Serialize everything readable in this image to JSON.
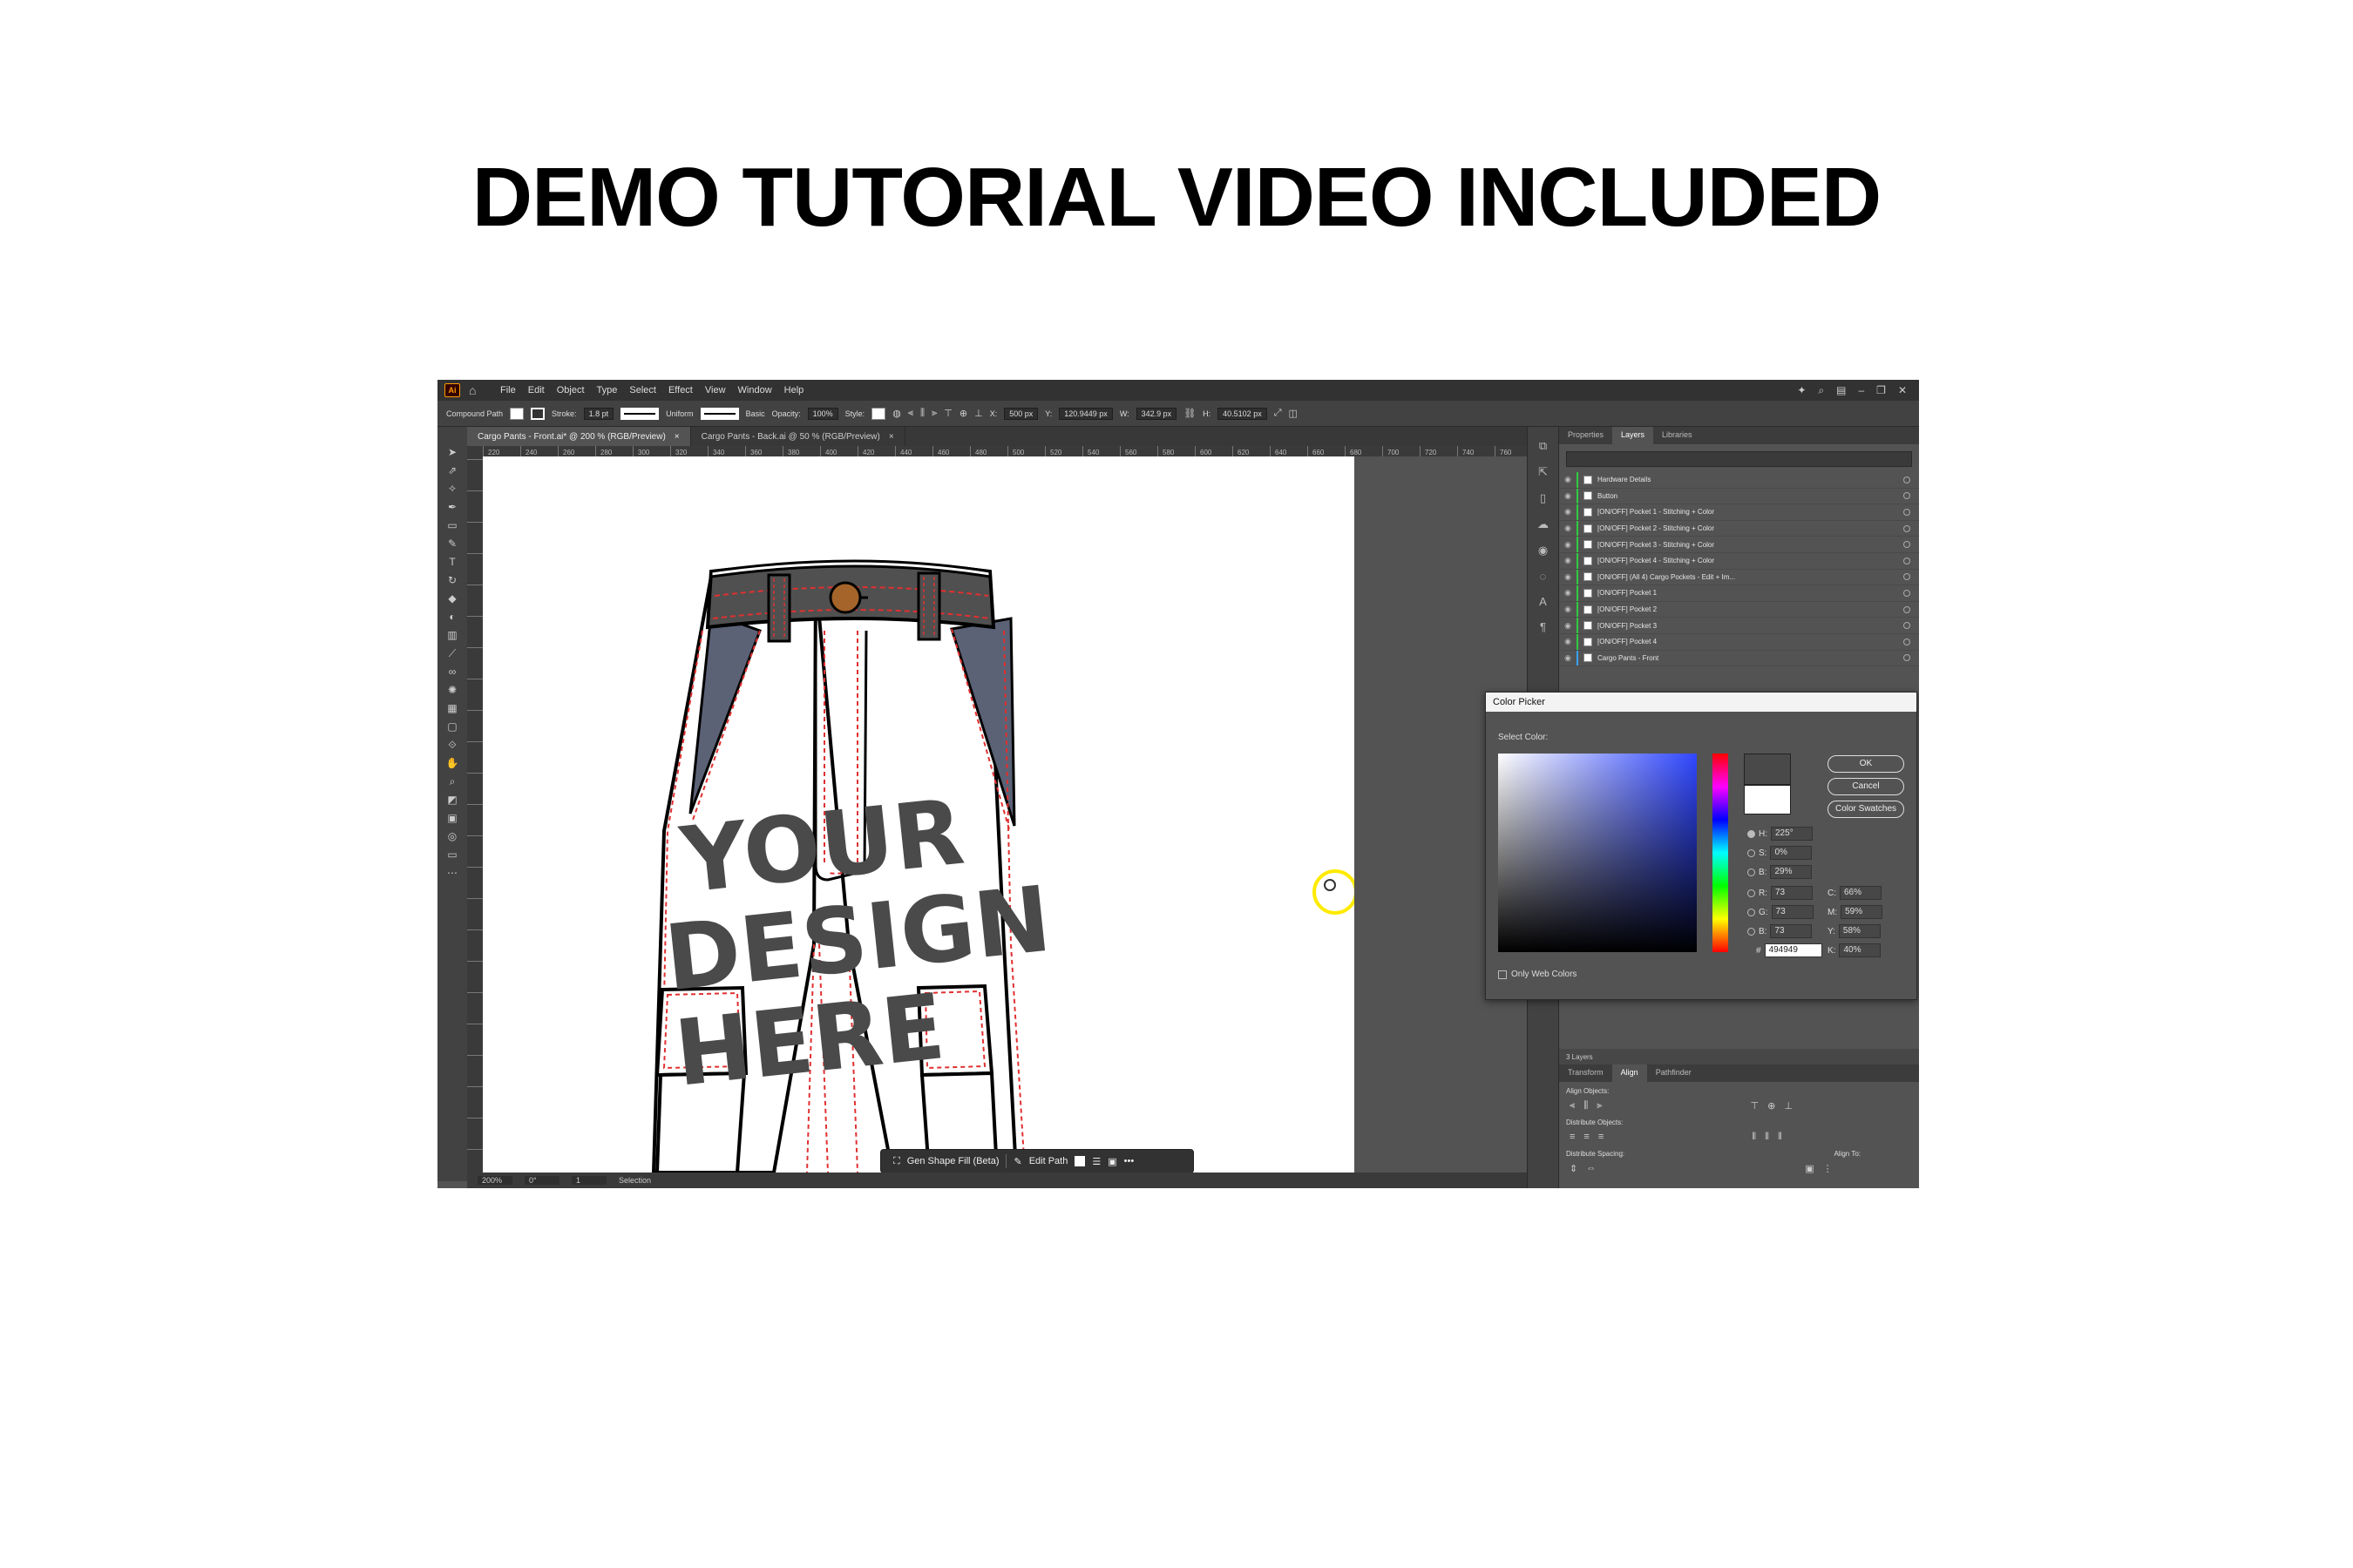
{
  "headline": "DEMO TUTORIAL VIDEO INCLUDED",
  "app": {
    "logo": "Ai",
    "menu": [
      "File",
      "Edit",
      "Object",
      "Type",
      "Select",
      "Effect",
      "View",
      "Window",
      "Help"
    ],
    "control": {
      "object_type": "Compound Path",
      "stroke_label": "Stroke:",
      "stroke_value": "1.8 pt",
      "profile": "Uniform",
      "brush": "Basic",
      "opacity_label": "Opacity:",
      "opacity": "100%",
      "style_label": "Style:",
      "x_label": "X:",
      "x": "500 px",
      "y_label": "Y:",
      "y": "120.9449 px",
      "w_label": "W:",
      "w": "342.9 px",
      "h_label": "H:",
      "h": "40.5102 px"
    },
    "tabs": [
      {
        "label": "Cargo Pants - Front.ai* @ 200 % (RGB/Preview)",
        "close": "×"
      },
      {
        "label": "Cargo Pants - Back.ai @ 50 % (RGB/Preview)",
        "close": "×"
      }
    ],
    "ruler_ticks": [
      "220",
      "240",
      "260",
      "280",
      "300",
      "320",
      "340",
      "360",
      "380",
      "400",
      "420",
      "440",
      "460",
      "480",
      "500",
      "520",
      "540",
      "560",
      "580",
      "600",
      "620",
      "640",
      "660",
      "680",
      "700",
      "720",
      "740",
      "760"
    ],
    "artwork_text": [
      "YOUR",
      "DESIGN",
      "HERE"
    ],
    "context_bar": {
      "gen_fill": "Gen Shape Fill (Beta)",
      "edit_path": "Edit Path",
      "more": "•••"
    },
    "status": {
      "zoom": "200%",
      "rotate": "0°",
      "artboard": "1",
      "tool": "Selection"
    },
    "panel_tabs": [
      "Properties",
      "Layers",
      "Libraries"
    ],
    "active_panel": "Layers",
    "layers": [
      {
        "name": "Hardware Details",
        "bar": "green"
      },
      {
        "name": "Button",
        "bar": "green"
      },
      {
        "name": "[ON/OFF] Pocket 1 - Stitching + Color",
        "bar": "green"
      },
      {
        "name": "[ON/OFF] Pocket 2 - Stitching + Color",
        "bar": "green"
      },
      {
        "name": "[ON/OFF] Pocket 3 - Stitching + Color",
        "bar": "green"
      },
      {
        "name": "[ON/OFF] Pocket 4 - Stitching + Color",
        "bar": "green"
      },
      {
        "name": "[ON/OFF] (All 4) Cargo Pockets - Edit + Im...",
        "bar": "green"
      },
      {
        "name": "[ON/OFF] Pocket 1",
        "bar": "green"
      },
      {
        "name": "[ON/OFF] Pocket 2",
        "bar": "green"
      },
      {
        "name": "[ON/OFF] Pocket 3",
        "bar": "green"
      },
      {
        "name": "[ON/OFF] Pocket 4",
        "bar": "green"
      },
      {
        "name": "Cargo Pants - Front",
        "bar": "blue"
      }
    ],
    "layers_count": "3 Layers",
    "align_tabs": [
      "Transform",
      "Align",
      "Pathfinder"
    ],
    "align_sections": {
      "align_objects": "Align Objects:",
      "distribute_objects": "Distribute Objects:",
      "distribute_spacing": "Distribute Spacing:",
      "align_to": "Align To:"
    },
    "color_picker": {
      "title": "Color Picker",
      "select_color": "Select Color:",
      "ok": "OK",
      "cancel": "Cancel",
      "swatches": "Color Swatches",
      "h_label": "H:",
      "h": "225°",
      "s_label": "S:",
      "s": "0%",
      "b_label": "B:",
      "b": "29%",
      "r_label": "R:",
      "r": "73",
      "g_label": "G:",
      "g": "73",
      "bl_label": "B:",
      "bl": "73",
      "c_label": "C:",
      "c": "66%",
      "m_label": "M:",
      "m": "59%",
      "yy_label": "Y:",
      "yy": "58%",
      "k_label": "K:",
      "k": "40%",
      "hex_label": "#",
      "hex": "494949",
      "web_only": "Only Web Colors",
      "new_color": "#494949",
      "old_color": "#ffffff"
    }
  }
}
